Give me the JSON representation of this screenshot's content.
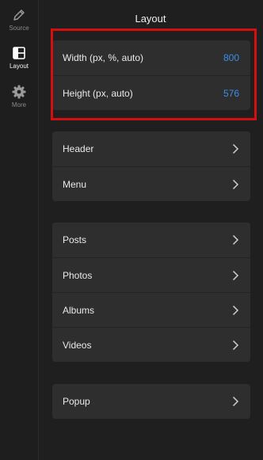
{
  "sidebar": {
    "items": [
      {
        "label": "Source",
        "icon": "pencil-icon",
        "active": false
      },
      {
        "label": "Layout",
        "icon": "layout-icon",
        "active": true
      },
      {
        "label": "More",
        "icon": "gear-icon",
        "active": false
      }
    ]
  },
  "panel": {
    "title": "Layout",
    "size_card": {
      "width_label": "Width (px, %, auto)",
      "width_value": "800",
      "height_label": "Height (px, auto)",
      "height_value": "576"
    },
    "structure_card": {
      "header_label": "Header",
      "menu_label": "Menu"
    },
    "content_card": {
      "posts_label": "Posts",
      "photos_label": "Photos",
      "albums_label": "Albums",
      "videos_label": "Videos"
    },
    "popup_card": {
      "popup_label": "Popup"
    }
  },
  "colors": {
    "background": "#1f1f1f",
    "card": "#2e2e2e",
    "accent_value": "#3b8fe6",
    "highlight": "#d30f0f"
  }
}
